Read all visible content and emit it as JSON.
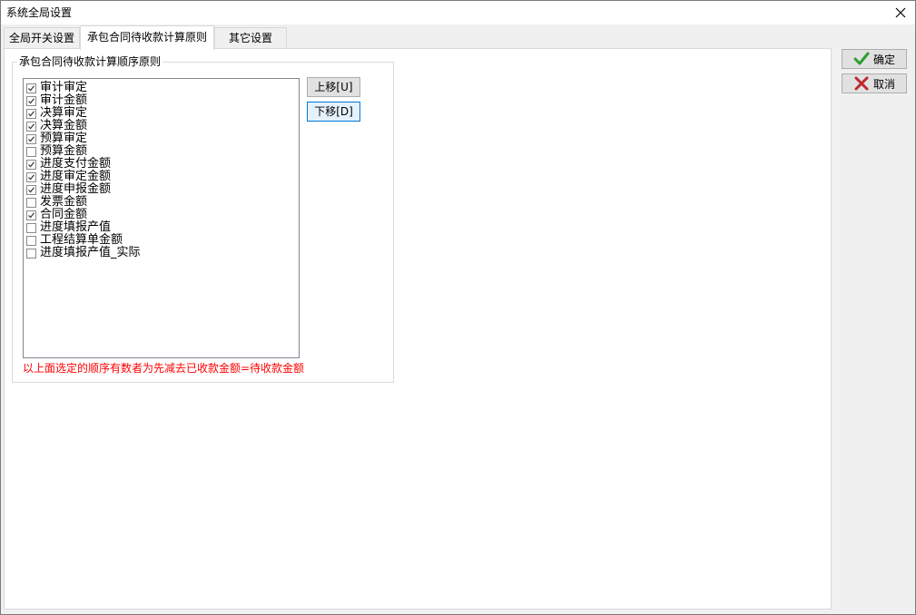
{
  "window": {
    "title": "系统全局设置"
  },
  "tabs": [
    {
      "label": "全局开关设置",
      "active": false
    },
    {
      "label": "承包合同待收款计算原则",
      "active": true
    },
    {
      "label": "其它设置",
      "active": false
    }
  ],
  "group": {
    "title": "承包合同待收款计算顺序原则",
    "items": [
      {
        "label": "审计审定",
        "checked": true
      },
      {
        "label": "审计金额",
        "checked": true
      },
      {
        "label": "决算审定",
        "checked": true
      },
      {
        "label": "决算金额",
        "checked": true
      },
      {
        "label": "预算审定",
        "checked": true
      },
      {
        "label": "预算金额",
        "checked": false
      },
      {
        "label": "进度支付金额",
        "checked": true
      },
      {
        "label": "进度审定金额",
        "checked": true
      },
      {
        "label": "进度申报金额",
        "checked": true
      },
      {
        "label": "发票金额",
        "checked": false
      },
      {
        "label": "合同金额",
        "checked": true
      },
      {
        "label": "进度填报产值",
        "checked": false
      },
      {
        "label": "工程结算单金额",
        "checked": false
      },
      {
        "label": "进度填报产值_实际",
        "checked": false
      }
    ],
    "move_up_label": "上移[U]",
    "move_down_label": "下移[D]",
    "hint": "以上面选定的顺序有数者为先减去已收款金额=待收款金额"
  },
  "actions": {
    "ok_label": "确定",
    "cancel_label": "取消"
  },
  "colors": {
    "hint": "#ff0000",
    "ok_icon": "#2e9e2e",
    "cancel_icon": "#c0282d",
    "focus_border": "#0078d7"
  },
  "icons": {
    "ok": "checkmark-icon",
    "cancel": "x-icon",
    "close": "close-icon"
  }
}
